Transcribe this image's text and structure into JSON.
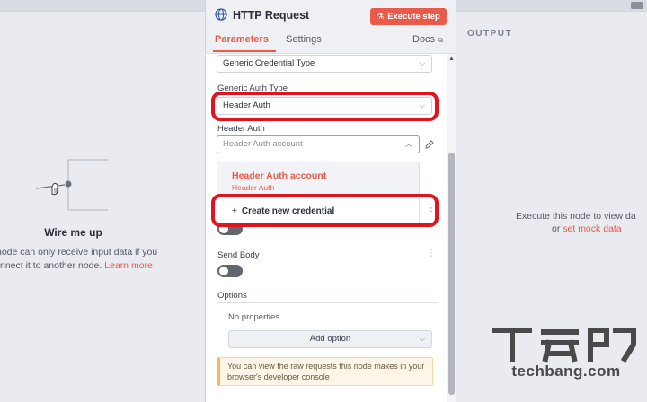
{
  "panel": {
    "title": "HTTP Request",
    "execute_label": "Execute step",
    "tabs": [
      {
        "label": "Parameters",
        "active": true
      },
      {
        "label": "Settings",
        "active": false
      }
    ],
    "docs_label": "Docs"
  },
  "form": {
    "credential_type_value": "Generic Credential Type",
    "generic_auth_type_label": "Generic Auth Type",
    "generic_auth_type_value": "Header Auth",
    "header_auth_label": "Header Auth",
    "header_auth_placeholder": "Header Auth account",
    "send_body_label": "Send Body",
    "options_label": "Options",
    "no_properties": "No properties",
    "add_option_label": "Add option",
    "info_text": "You can view the raw requests this node makes in your browser's developer console"
  },
  "dropdown": {
    "item_title": "Header Auth account",
    "item_subtitle": "Header Auth",
    "create_label": "Create new credential"
  },
  "left_pane": {
    "title": "Wire me up",
    "desc_line1": "node can only receive input data if you",
    "desc_line2_prefix": "nnect it to another node.",
    "learn_more": "Learn more"
  },
  "right_pane": {
    "title": "OUTPUT",
    "desc_line1": "Execute this node to view da",
    "desc_line2_prefix": "or",
    "mock_link": "set mock data"
  },
  "watermark": {
    "text": "techbang.com"
  },
  "colors": {
    "accent": "#ea5a4a",
    "highlight": "#e0141e"
  }
}
